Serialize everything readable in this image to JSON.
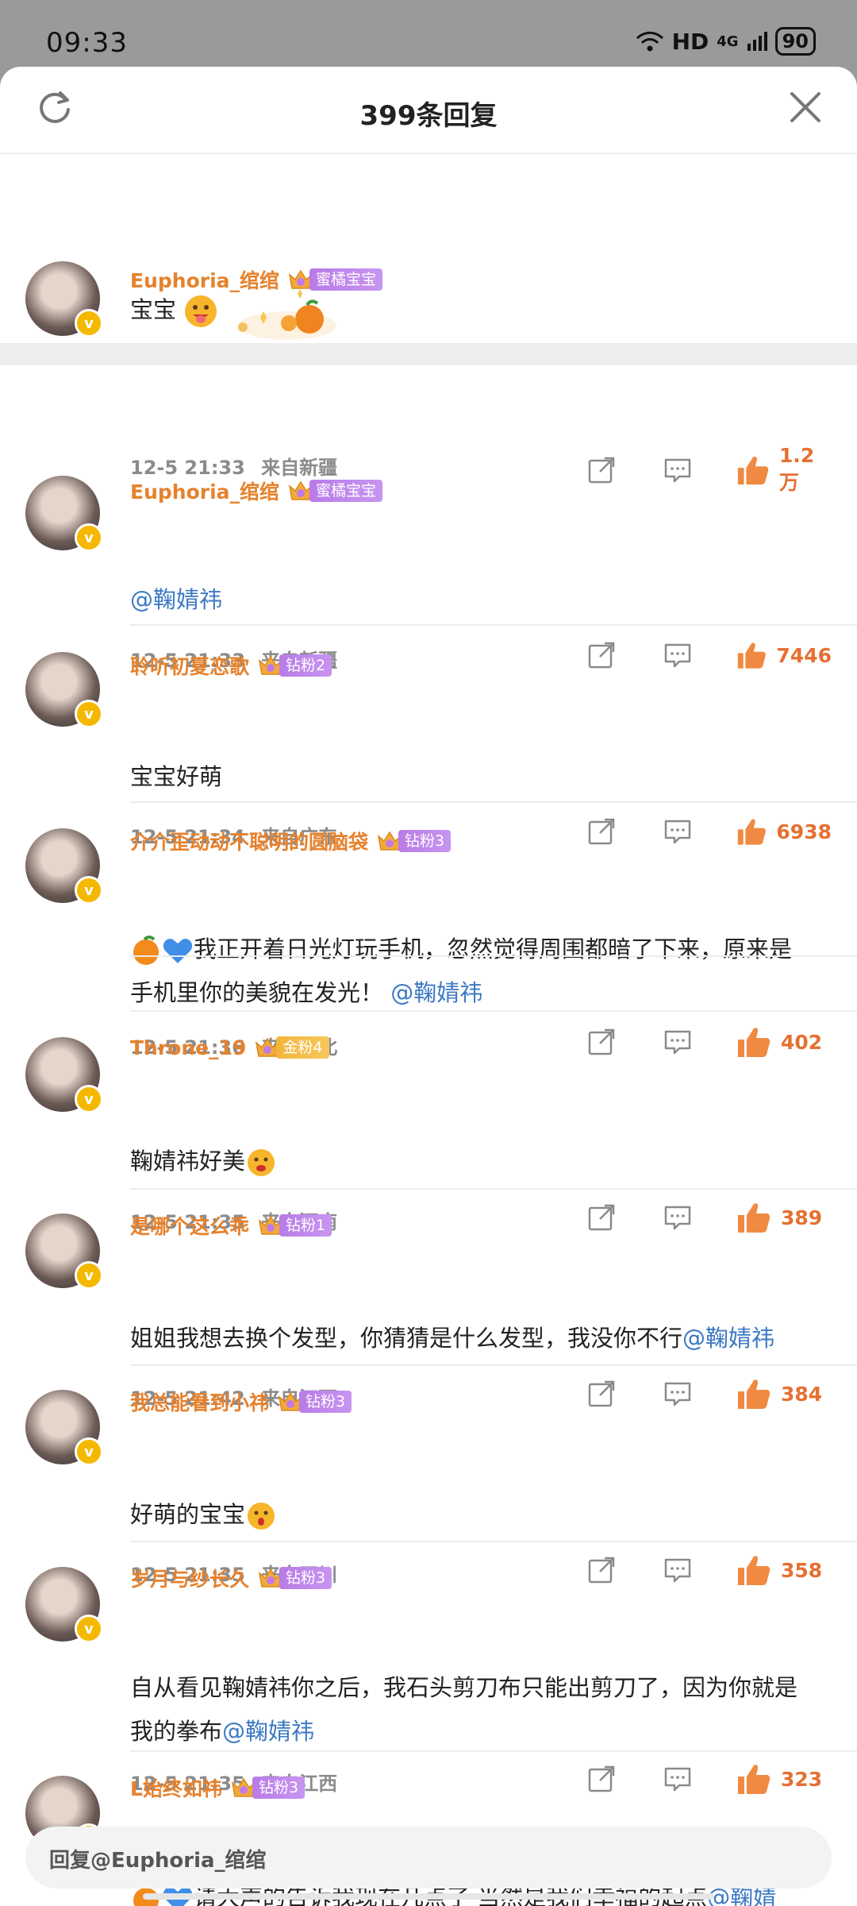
{
  "status": {
    "time": "09:33",
    "network": "HD",
    "signal": "4G",
    "battery": "90"
  },
  "header": {
    "title": "399条回复"
  },
  "colors": {
    "username": "#e6822d",
    "mention": "#3d79c2",
    "like": "#e57032",
    "fan_badge": "#b97be7",
    "fan_badge_gold": "#f2b53c"
  },
  "comments": [
    {
      "username": "Euphoria_绾绾",
      "fan_level": "",
      "fan_label": "蜜橘宝宝",
      "text": "宝宝",
      "time": "12-5  21:33",
      "location": "来自新疆",
      "likes": "1.2万"
    },
    {
      "username": "Euphoria_绾绾",
      "fan_level": "",
      "fan_label": "蜜橘宝宝",
      "mention": "@鞠婧祎",
      "time": "12-5  21:33",
      "location": "来自新疆",
      "likes": "7446"
    },
    {
      "username": "聆听初夏恋歌",
      "fan_level": "5",
      "fan_label": "钻粉2",
      "text": "宝宝好萌",
      "time": "12-5  21:34",
      "location": "来自广东",
      "likes": "6938"
    },
    {
      "username": "介介歪动动不聪明的圆脑袋",
      "fan_level": "6",
      "fan_label": "钻粉3",
      "text_line1": "我正开着日光灯玩手机，忽然觉得周围都暗了下来，原来是",
      "text_line2": "手机里你的美貌在发光！",
      "mention": "@鞠婧祎",
      "time": "12-5  21:36",
      "location": "来自河北",
      "likes": "402"
    },
    {
      "username": "Throne_19",
      "fan_level": "5",
      "fan_label": "金粉4",
      "text": "鞠婧祎好美",
      "time": "12-5  21:35",
      "location": "来自河南",
      "likes": "389"
    },
    {
      "username": "是哪个这么乖",
      "fan_level": "5",
      "fan_label": "钻粉1",
      "text": "姐姐我想去换个发型，你猜猜是什么发型，我没你不行",
      "mention": "@鞠婧祎",
      "time": "12-5  21:42",
      "location": "来自江西",
      "likes": "384"
    },
    {
      "username": "我总能看到小祎",
      "fan_level": "",
      "fan_label": "钻粉3",
      "text": "好萌的宝宝",
      "time": "12-5  21:35",
      "location": "来自四川",
      "likes": "358"
    },
    {
      "username": "岁月与纱长久",
      "fan_level": "6",
      "fan_label": "钻粉3",
      "text_line1": "自从看见鞠婧祎你之后，我石头剪刀布只能出剪刀了，因为你就是",
      "text_line2": "我的拳布",
      "mention": "@鞠婧祎",
      "time": "12-5  21:35",
      "location": "来自江西",
      "likes": "323"
    },
    {
      "username": "L始终如祎",
      "fan_level": "6",
      "fan_label": "钻粉3",
      "text_line1": "请大声的告诉我现在几点了  当然是我们幸福的起点",
      "mention_part1": "@鞠婧",
      "mention_part2": "祎"
    }
  ],
  "reply_bar": {
    "placeholder": "回复@Euphoria_绾绾"
  }
}
